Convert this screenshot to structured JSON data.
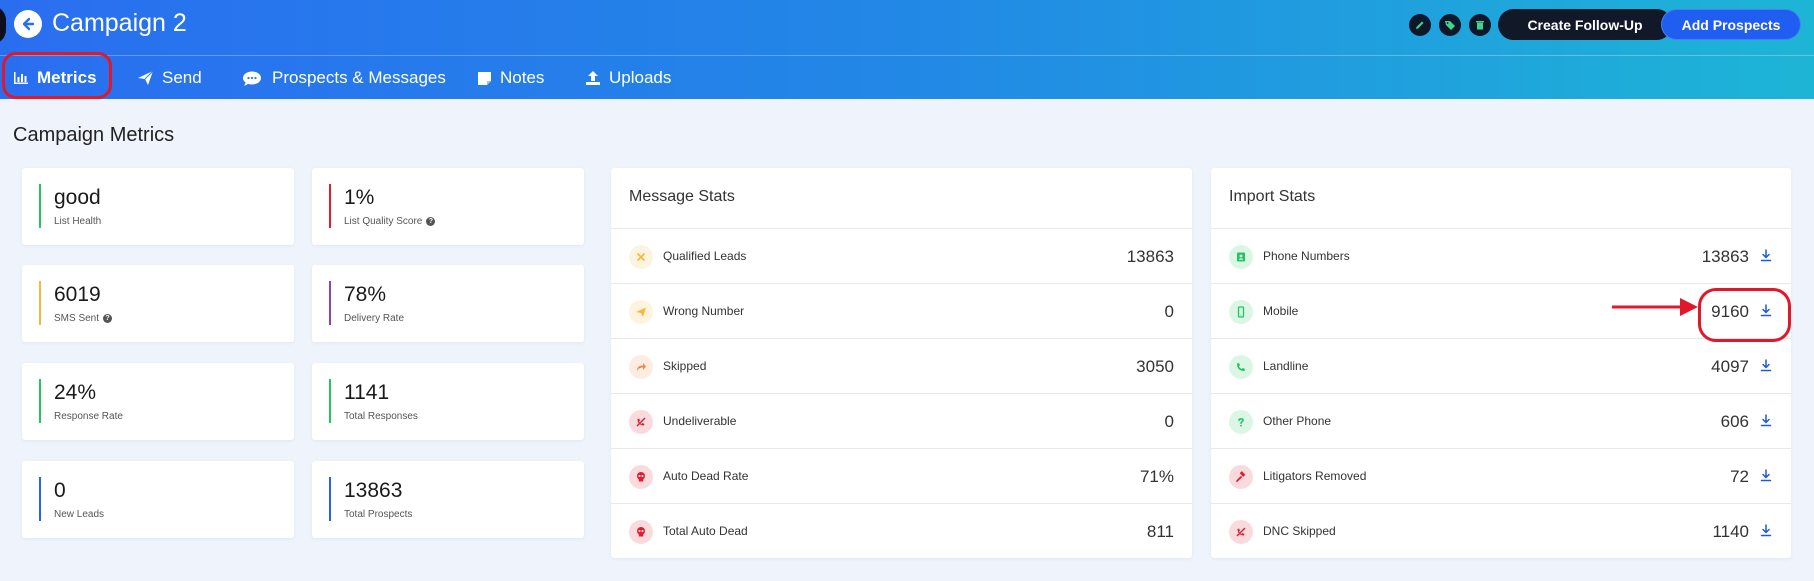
{
  "header": {
    "title": "Campaign 2",
    "create_followup_label": "Create Follow-Up",
    "add_prospects_label": "Add Prospects"
  },
  "tabs": [
    {
      "label": "Metrics",
      "icon": "bar-chart-icon",
      "active": true
    },
    {
      "label": "Send",
      "icon": "paper-plane-icon"
    },
    {
      "label": "Prospects & Messages",
      "icon": "chat-bubbles-icon"
    },
    {
      "label": "Notes",
      "icon": "sticky-note-icon"
    },
    {
      "label": "Uploads",
      "icon": "upload-icon"
    }
  ],
  "section_title": "Campaign Metrics",
  "metrics": [
    {
      "value": "good",
      "label": "List Health",
      "color": "#22c55e"
    },
    {
      "value": "1%",
      "label": "List Quality Score",
      "color": "#e11d2e",
      "help": true
    },
    {
      "value": "6019",
      "label": "SMS Sent",
      "color": "#f5b83a",
      "help": true
    },
    {
      "value": "78%",
      "label": "Delivery Rate",
      "color": "#8e44ad"
    },
    {
      "value": "24%",
      "label": "Response Rate",
      "color": "#22c55e"
    },
    {
      "value": "1141",
      "label": "Total Responses",
      "color": "#22c55e"
    },
    {
      "value": "0",
      "label": "New Leads",
      "color": "#2563eb"
    },
    {
      "value": "13863",
      "label": "Total Prospects",
      "color": "#2563eb"
    }
  ],
  "message_stats": {
    "title": "Message Stats",
    "rows": [
      {
        "label": "Qualified Leads",
        "value": "13863",
        "icon": "x-icon",
        "color": "#f5b83a"
      },
      {
        "label": "Wrong Number",
        "value": "0",
        "icon": "paper-plane-icon",
        "color": "#f5b83a"
      },
      {
        "label": "Skipped",
        "value": "3050",
        "icon": "share-arrow-icon",
        "color": "#f08a4b"
      },
      {
        "label": "Undeliverable",
        "value": "0",
        "icon": "phone-slash-icon",
        "color": "#e11d2e"
      },
      {
        "label": "Auto Dead Rate",
        "value": "71%",
        "icon": "skull-icon",
        "color": "#e11d2e"
      },
      {
        "label": "Total Auto Dead",
        "value": "811",
        "icon": "skull-icon",
        "color": "#e11d2e"
      }
    ]
  },
  "import_stats": {
    "title": "Import Stats",
    "rows": [
      {
        "label": "Phone Numbers",
        "value": "13863",
        "icon": "contact-card-icon",
        "color": "#22c55e"
      },
      {
        "label": "Mobile",
        "value": "9160",
        "icon": "mobile-phone-icon",
        "color": "#22c55e"
      },
      {
        "label": "Landline",
        "value": "4097",
        "icon": "phone-icon",
        "color": "#22c55e"
      },
      {
        "label": "Other Phone",
        "value": "606",
        "icon": "question-icon",
        "color": "#22c55e"
      },
      {
        "label": "Litigators Removed",
        "value": "72",
        "icon": "gavel-icon",
        "color": "#e11d2e"
      },
      {
        "label": "DNC Skipped",
        "value": "1140",
        "icon": "phone-slash-icon",
        "color": "#e11d2e"
      }
    ]
  }
}
